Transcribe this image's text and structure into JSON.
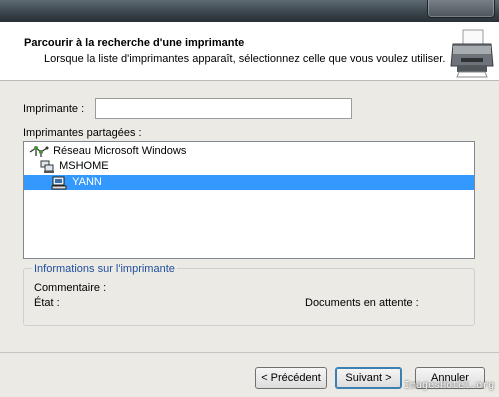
{
  "header": {
    "title": "Parcourir à la recherche d'une imprimante",
    "subtitle": "Lorsque la liste d'imprimantes apparaît, sélectionnez celle que vous voulez utiliser."
  },
  "form": {
    "printer_label": "Imprimante :",
    "printer_value": "",
    "shared_label": "Imprimantes partagées :"
  },
  "tree": {
    "items": [
      {
        "label": "Réseau Microsoft Windows",
        "icon": "network-icon",
        "selected": false
      },
      {
        "label": "MSHOME",
        "icon": "workgroup-icon",
        "selected": false
      },
      {
        "label": "YANN",
        "icon": "computer-icon",
        "selected": true
      }
    ]
  },
  "info": {
    "group_title": "Informations sur l'imprimante",
    "comment_label": "Commentaire :",
    "state_label": "État :",
    "pending_label": "Documents en attente :"
  },
  "buttons": {
    "back": "< Précédent",
    "next": "Suivant >",
    "cancel": "Annuler"
  },
  "watermark": "ImagesHotel.org",
  "colors": {
    "selection": "#3399ff",
    "group_title": "#1f4e9e"
  }
}
